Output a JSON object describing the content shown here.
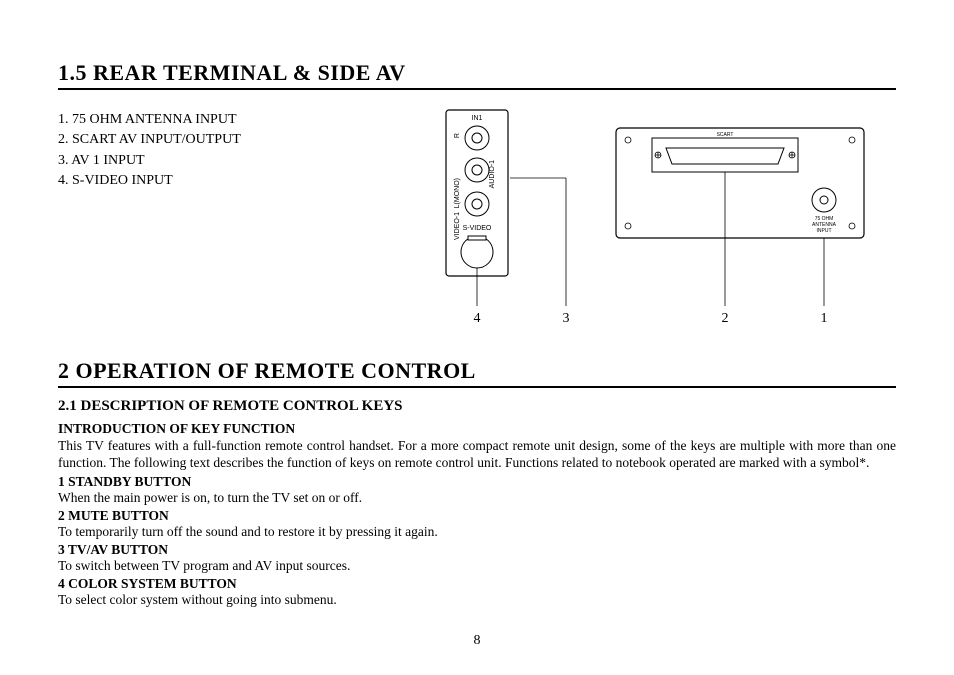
{
  "section1": {
    "heading": "1.5 REAR TERMINAL & SIDE AV",
    "list": [
      "1.  75 OHM ANTENNA INPUT",
      "2.  SCART AV INPUT/OUTPUT",
      "3.  AV 1 INPUT",
      "4.   S-VIDEO INPUT"
    ],
    "panel_side": {
      "title": "IN1",
      "labels": {
        "r": "R",
        "audio": "AUDIO-1",
        "l_mono": "L(MONO)",
        "video": "VIDEO-1",
        "svideo": "S-VIDEO"
      }
    },
    "panel_rear": {
      "scart_label": "SCART",
      "antenna_label": "75 OHM ANTENNA INPUT"
    },
    "callouts": {
      "c1": "1",
      "c2": "2",
      "c3": "3",
      "c4": "4"
    }
  },
  "section2": {
    "heading": "2 OPERATION OF REMOTE CONTROL",
    "subheading": "2.1 DESCRIPTION OF REMOTE CONTROL KEYS",
    "intro_head": "INTRODUCTION OF KEY FUNCTION",
    "intro_body": "This TV features with a full-function remote control handset. For a more compact remote unit design, some of the keys are multiple with more than one function. The following text describes the function of keys on remote control unit. Functions related to notebook operated are marked with a symbol*.",
    "keys": [
      {
        "head": "1 STANDBY BUTTON",
        "body": "When the main power is on, to turn the TV set on or off."
      },
      {
        "head": "2  MUTE BUTTON",
        "body": "To temporarily turn off the sound and to restore it by pressing it again."
      },
      {
        "head": "3 TV/AV BUTTON",
        "body": "To switch between TV program and AV input sources."
      },
      {
        "head": "4 COLOR SYSTEM BUTTON",
        "body": "To select color system without going into submenu."
      }
    ]
  },
  "page_number": "8"
}
